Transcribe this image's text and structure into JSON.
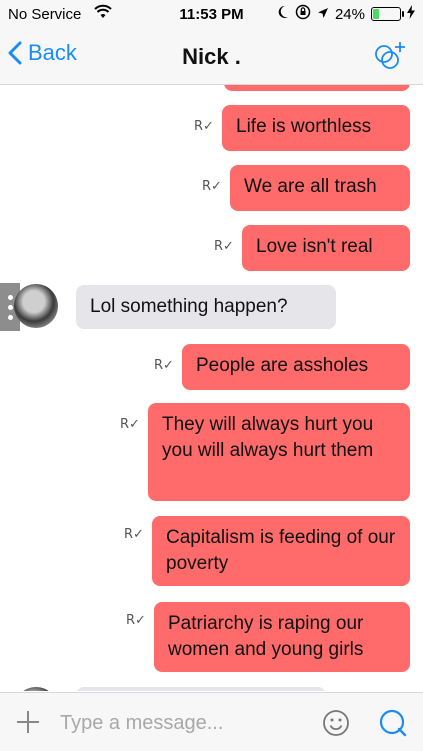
{
  "status_bar": {
    "carrier": "No Service",
    "time": "11:53 PM",
    "battery_percent": "24%",
    "battery_level": 0.24,
    "icons": [
      "wifi-icon",
      "moon-icon",
      "orientation-lock-icon",
      "location-icon",
      "battery-icon",
      "charging-icon"
    ]
  },
  "nav": {
    "back_label": "Back",
    "title": "Nick .",
    "accent_color": "#1a8cf5"
  },
  "messages": [
    {
      "direction": "outgoing",
      "text": "Life is worthless",
      "receipt": "R"
    },
    {
      "direction": "outgoing",
      "text": "We are all trash",
      "receipt": "R"
    },
    {
      "direction": "outgoing",
      "text": "Love isn't real",
      "receipt": "R"
    },
    {
      "direction": "incoming",
      "text": "Lol something happen?"
    },
    {
      "direction": "outgoing",
      "text": "People are assholes",
      "receipt": "R"
    },
    {
      "direction": "outgoing",
      "text": "They will always hurt you you will always hurt them",
      "receipt": "R"
    },
    {
      "direction": "outgoing",
      "text": "Capitalism is feeding of our poverty",
      "receipt": "R"
    },
    {
      "direction": "outgoing",
      "text": "Patriarchy is raping our women and young girls",
      "receipt": "R"
    }
  ],
  "colors": {
    "outgoing_bubble": "#ff6b6b",
    "incoming_bubble": "#e6e6ea"
  },
  "input": {
    "placeholder": "Type a message..."
  }
}
